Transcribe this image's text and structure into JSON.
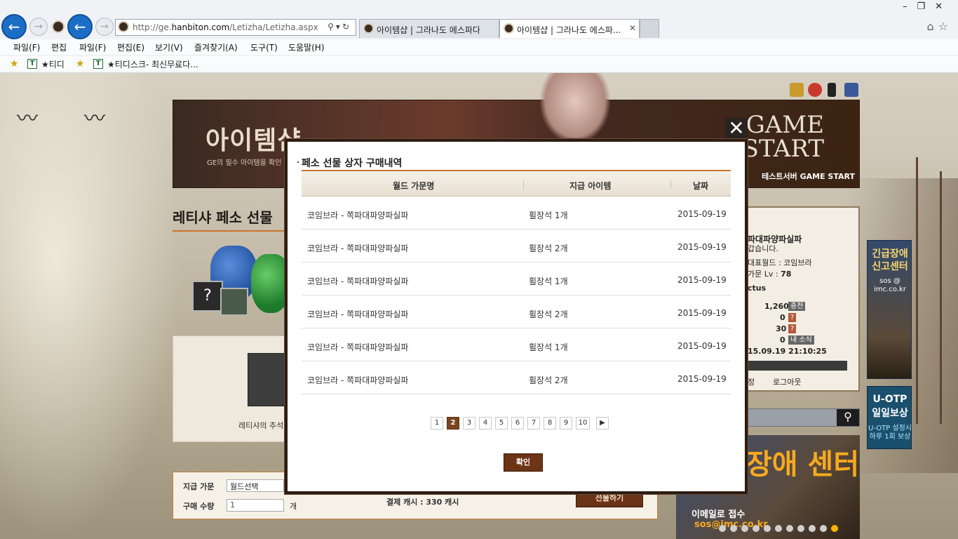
{
  "browser": {
    "url_prefix": "http://ge.",
    "url_domain": "hanbiton.com",
    "url_path": "/Letizha/Letizha.aspx",
    "tabs": [
      {
        "title": "아이템샵 | 그라나도 에스파다"
      },
      {
        "title": "아이템샵 | 그라나도 에스파...",
        "close": "✕"
      }
    ],
    "menu_left": [
      "파일(F)",
      "편집"
    ],
    "menu": [
      "파일(F)",
      "편집(E)",
      "보기(V)",
      "즐겨찾기(A)",
      "도구(T)",
      "도움말(H)"
    ],
    "fav_left": "★티디",
    "fav": "★티디스크- 최신무료다..."
  },
  "page": {
    "banner_title": "아이템샵",
    "banner_sub": "GE의 필수 아이템을 확인",
    "game_start_1": "GAME",
    "game_start_2": "START",
    "test_server": "테스트서버 GAME START",
    "page_title": "레티샤 페소 선물",
    "content_label": "레티샤의 추석",
    "order": {
      "giver_label": "지급 가문",
      "world_select": "월드선택",
      "qty_label": "구매 수량",
      "qty_value": "1",
      "qty_unit": "개",
      "payment": "결제 캐시 : 330 캐시",
      "buy": "선물하기"
    },
    "user": {
      "family": "파대파양파실파",
      "greeting": "갑습니다.",
      "world": "대표월드 : 코임브라",
      "level_label": "가문 Lv :",
      "level": "78",
      "cactus": "ctus",
      "v1": "1,260",
      "charge": "충전",
      "v2": "0",
      "v3": "30",
      "v4": "0",
      "mynews": "내 소식",
      "datetime": "15.09.19 21:10:25",
      "left_link": "정",
      "logout": "로그아웃"
    },
    "ads": {
      "sos_title": "긴급장애 신고센터",
      "sos_sub": "sos @ imc.co.kr",
      "otp_title": "U-OTP 일일보상",
      "otp_sub": "U-OTP 설정시 하루 1회 보상",
      "big_title": "장애 센터",
      "big_email": "이메일로 접수",
      "big_addr": "sos@imc.co.kr"
    }
  },
  "modal": {
    "title": "페소 선물 상자 구매내역",
    "close": "✕",
    "columns": [
      "월드 가문명",
      "지급 아이템",
      "날짜"
    ],
    "rows": [
      {
        "world": "코임브라 - 쪽파대파양파실파",
        "item": "휠장석 1개",
        "date": "2015-09-19"
      },
      {
        "world": "코임브라 - 쪽파대파양파실파",
        "item": "휠장석 2개",
        "date": "2015-09-19"
      },
      {
        "world": "코임브라 - 쪽파대파양파실파",
        "item": "휠장석 1개",
        "date": "2015-09-19"
      },
      {
        "world": "코임브라 - 쪽파대파양파실파",
        "item": "휠장석 2개",
        "date": "2015-09-19"
      },
      {
        "world": "코임브라 - 쪽파대파양파실파",
        "item": "휠장석 1개",
        "date": "2015-09-19"
      },
      {
        "world": "코임브라 - 쪽파대파양파실파",
        "item": "휠장석 2개",
        "date": "2015-09-19"
      }
    ],
    "pages": [
      "1",
      "2",
      "3",
      "4",
      "5",
      "6",
      "7",
      "8",
      "9",
      "10"
    ],
    "current_page": "2",
    "next": "▶",
    "confirm": "확인"
  }
}
